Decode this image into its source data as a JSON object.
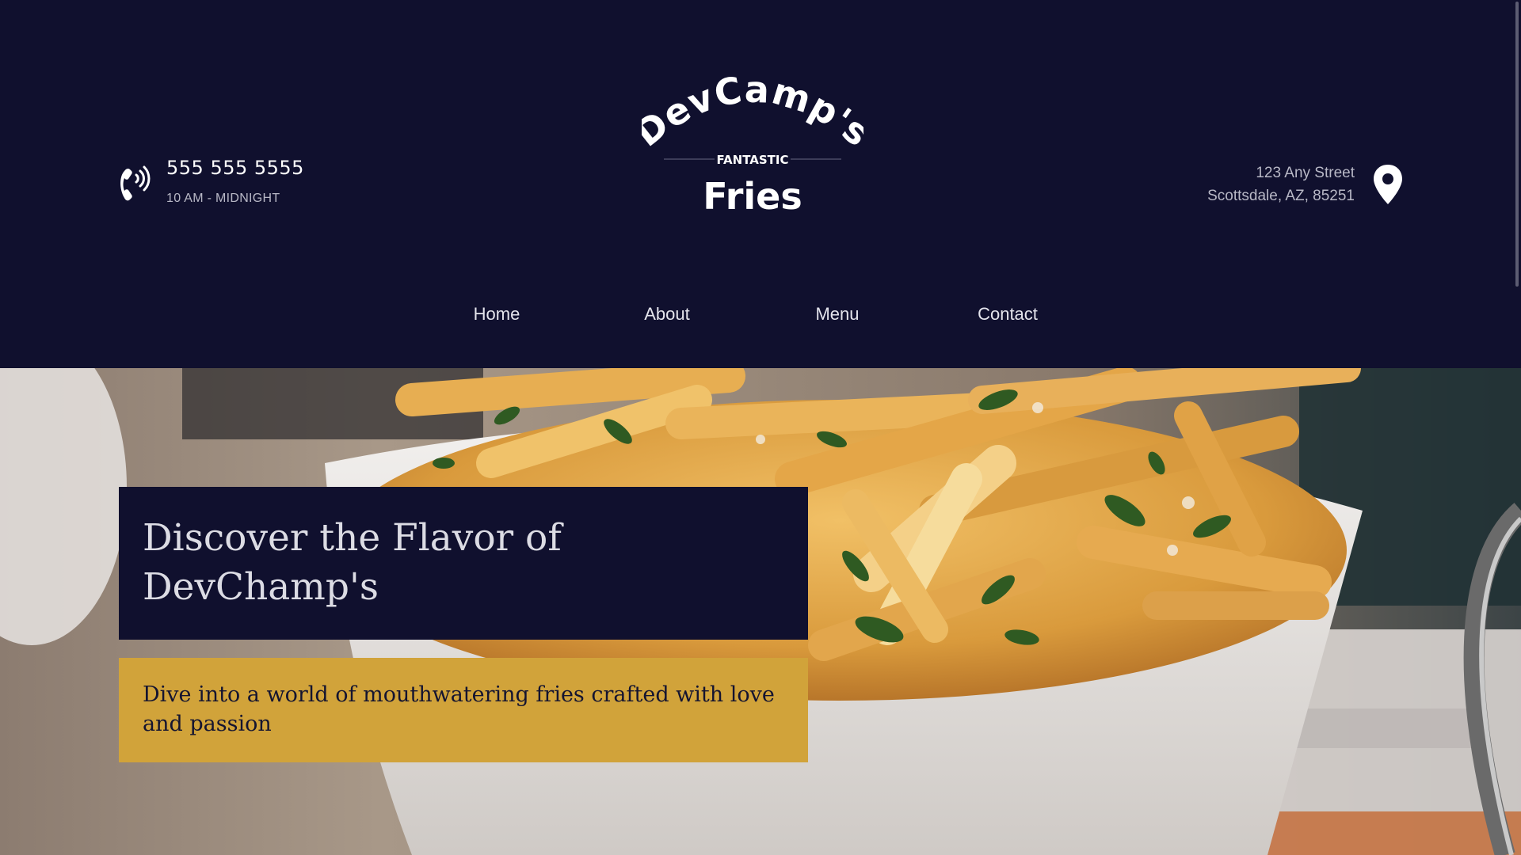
{
  "header": {
    "contact": {
      "phone": "555 555 5555",
      "hours": "10 AM - MIDNIGHT",
      "icon": "phone-icon"
    },
    "logo": {
      "line1": "DevCamp's",
      "line2": "FANTASTIC",
      "line3": "Fries"
    },
    "address": {
      "street": "123 Any Street",
      "city": "Scottsdale, AZ, 85251",
      "icon": "map-pin-icon"
    },
    "nav": [
      {
        "label": "Home"
      },
      {
        "label": "About"
      },
      {
        "label": "Menu"
      },
      {
        "label": "Contact"
      }
    ]
  },
  "hero": {
    "title": "Discover the Flavor of DevChamp's",
    "subtitle": "Dive into a world of mouthwatering fries crafted with love and passion",
    "image": "fries-in-bowl-photo"
  },
  "colors": {
    "navy": "#10102e",
    "gold": "#d1a33a",
    "text_light": "#e4e4ec",
    "text_muted": "#b8b8c6"
  }
}
